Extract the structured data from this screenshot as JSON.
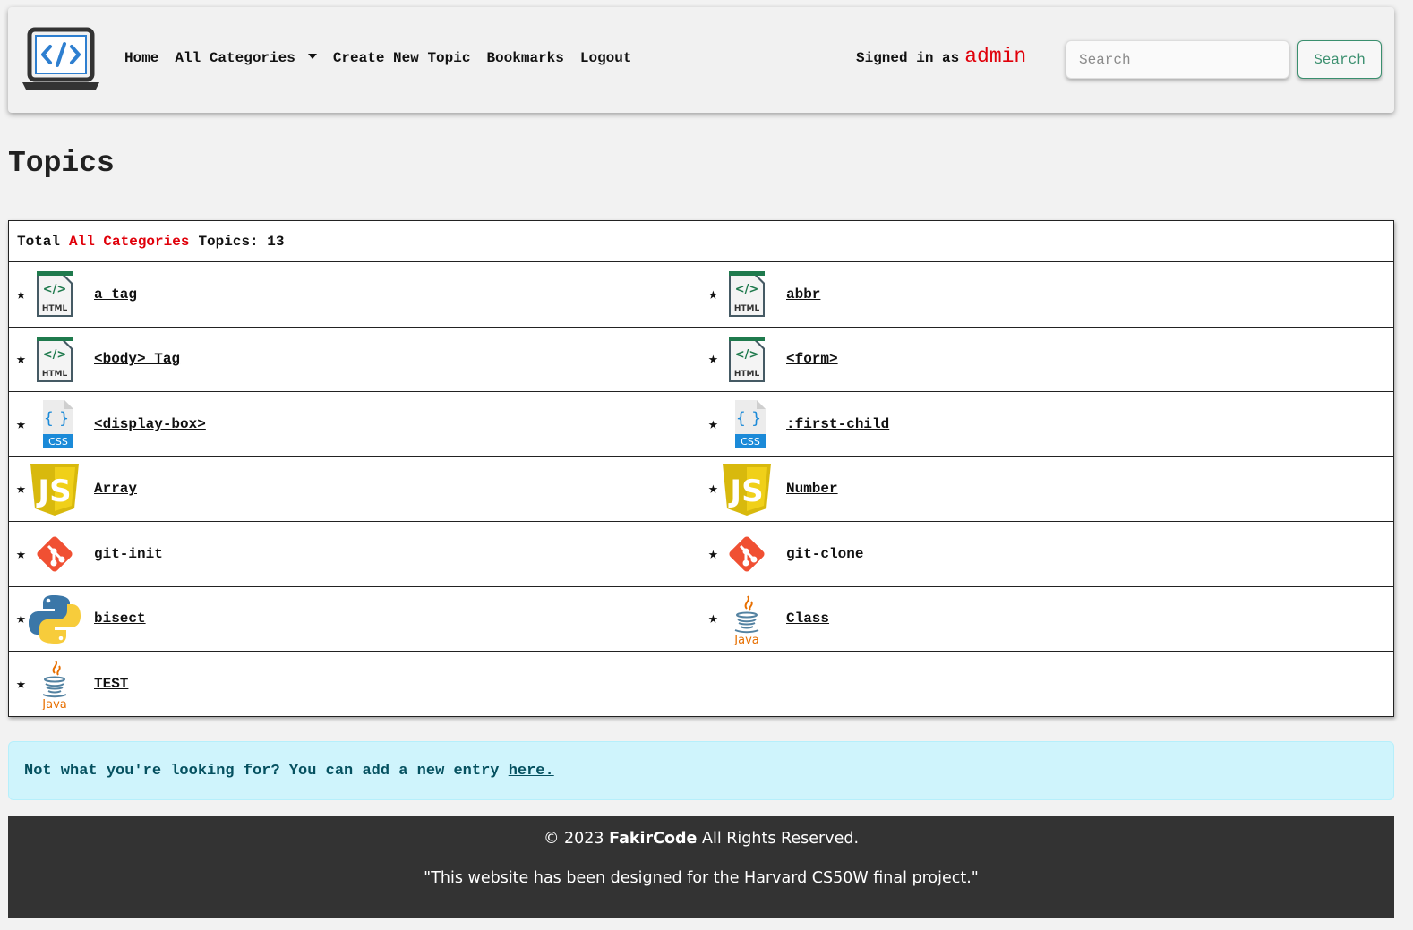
{
  "nav": {
    "home": "Home",
    "categories": "All Categories",
    "create": "Create New Topic",
    "bookmarks": "Bookmarks",
    "logout": "Logout",
    "signed_in_label": "Signed in as",
    "username": "admin",
    "search_placeholder": "Search",
    "search_button": "Search"
  },
  "page_title": "Topics",
  "summary": {
    "prefix": "Total",
    "category": "All Categories",
    "suffix": "Topics: 13"
  },
  "topics": [
    {
      "title": "a tag",
      "icon": "html-file-icon"
    },
    {
      "title": "abbr",
      "icon": "html-file-icon"
    },
    {
      "title": "<body> Tag",
      "icon": "html-file-icon"
    },
    {
      "title": "<form>",
      "icon": "html-file-icon"
    },
    {
      "title": "<display-box>",
      "icon": "css-file-icon"
    },
    {
      "title": ":first-child",
      "icon": "css-file-icon"
    },
    {
      "title": "Array",
      "icon": "javascript-icon"
    },
    {
      "title": "Number",
      "icon": "javascript-icon"
    },
    {
      "title": "git-init",
      "icon": "git-icon"
    },
    {
      "title": "git-clone",
      "icon": "git-icon"
    },
    {
      "title": "bisect",
      "icon": "python-icon"
    },
    {
      "title": "Class",
      "icon": "java-icon"
    },
    {
      "title": "TEST",
      "icon": "java-icon"
    }
  ],
  "star_glyph": "★",
  "alert": {
    "text": "Not what you're looking for? You can add a new entry ",
    "link": "here."
  },
  "footer": {
    "copyright": "© 2023",
    "brand": "FakirCode",
    "rights": "All Rights Reserved.",
    "note": "\"This website has been designed for the Harvard CS50W final project.\""
  },
  "colors": {
    "accent_red": "#e0000a",
    "search_green": "#3a8f6e",
    "alert_bg": "#cff4fc",
    "footer_bg": "#333333"
  }
}
